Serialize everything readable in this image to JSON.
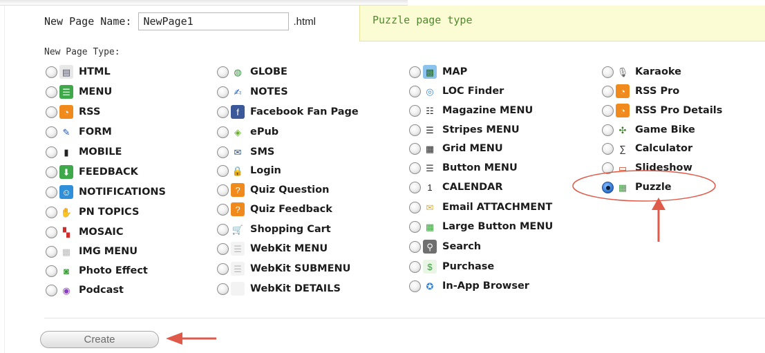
{
  "form": {
    "name_label": "New Page Name:",
    "name_value": "NewPage1",
    "extension": ".html",
    "hint": "Puzzle page type",
    "type_label": "New Page Type:",
    "create_label": "Create"
  },
  "selected": "Puzzle",
  "columns": [
    [
      {
        "label": "HTML",
        "icon": "document-icon",
        "glyph": "▤",
        "color": "#e8e8e8",
        "fg": "#556"
      },
      {
        "label": "MENU",
        "icon": "menu-list-icon",
        "glyph": "☰",
        "color": "#3fa84a",
        "fg": "#fff"
      },
      {
        "label": "RSS",
        "icon": "rss-icon",
        "glyph": "◔",
        "color": "#f08a1c",
        "fg": "#fff"
      },
      {
        "label": "FORM",
        "icon": "pencil-icon",
        "glyph": "✎",
        "color": "#ffffff",
        "fg": "#1b4fb0"
      },
      {
        "label": "MOBILE",
        "icon": "mobile-phone-icon",
        "glyph": "▮",
        "color": "#ffffff",
        "fg": "#222"
      },
      {
        "label": "FEEDBACK",
        "icon": "download-arrow-icon",
        "glyph": "⬇",
        "color": "#3fa84a",
        "fg": "#fff"
      },
      {
        "label": "NOTIFICATIONS",
        "icon": "smiley-notification-icon",
        "glyph": "☺",
        "color": "#2f8fd8",
        "fg": "#fff"
      },
      {
        "label": "PN TOPICS",
        "icon": "hand-topics-icon",
        "glyph": "✋",
        "color": "#ffffff",
        "fg": "#e0a020"
      },
      {
        "label": "MOSAIC",
        "icon": "mosaic-icon",
        "glyph": "▚",
        "color": "#ffffff",
        "fg": "#d42b2b"
      },
      {
        "label": "IMG MENU",
        "icon": "image-grid-icon",
        "glyph": "▦",
        "color": "#ffffff",
        "fg": "#bbb"
      },
      {
        "label": "Photo Effect",
        "icon": "camera-icon",
        "glyph": "◙",
        "color": "#ffffff",
        "fg": "#3b9a3b"
      },
      {
        "label": "Podcast",
        "icon": "podcast-icon",
        "glyph": "◉",
        "color": "#ffffff",
        "fg": "#8a3fc4"
      }
    ],
    [
      {
        "label": "GLOBE",
        "icon": "globe-icon",
        "glyph": "◍",
        "color": "#ffffff",
        "fg": "#2f8f3a"
      },
      {
        "label": "NOTES",
        "icon": "notes-icon",
        "glyph": "✍",
        "color": "#ffffff",
        "fg": "#2b5fb0"
      },
      {
        "label": "Facebook Fan Page",
        "icon": "facebook-icon",
        "glyph": "f",
        "color": "#3b5998",
        "fg": "#fff"
      },
      {
        "label": "ePub",
        "icon": "epub-icon",
        "glyph": "◈",
        "color": "#ffffff",
        "fg": "#6ab02f"
      },
      {
        "label": "SMS",
        "icon": "envelope-icon",
        "glyph": "✉",
        "color": "#ffffff",
        "fg": "#2a4f8a"
      },
      {
        "label": "Login",
        "icon": "lock-icon",
        "glyph": "🔒",
        "color": "#ffffff",
        "fg": "#c99a10"
      },
      {
        "label": "Quiz Question",
        "icon": "quiz-question-icon",
        "glyph": "?",
        "color": "#f08a1c",
        "fg": "#fff"
      },
      {
        "label": "Quiz Feedback",
        "icon": "quiz-feedback-icon",
        "glyph": "?",
        "color": "#f08a1c",
        "fg": "#fff"
      },
      {
        "label": "Shopping Cart",
        "icon": "shopping-cart-icon",
        "glyph": "🛒",
        "color": "#ffffff",
        "fg": "#222"
      },
      {
        "label": "WebKit MENU",
        "icon": "webkit-menu-icon",
        "glyph": "☰",
        "color": "#f3f3f3",
        "fg": "#bbb"
      },
      {
        "label": "WebKit SUBMENU",
        "icon": "webkit-submenu-icon",
        "glyph": "☰",
        "color": "#f3f3f3",
        "fg": "#bbb"
      },
      {
        "label": "WebKit DETAILS",
        "icon": "webkit-details-icon",
        "glyph": "",
        "color": "#f3f3f3",
        "fg": "#bbb"
      }
    ],
    [
      {
        "label": "MAP",
        "icon": "map-icon",
        "glyph": "▩",
        "color": "#8cc3ec",
        "fg": "#2a6e2a"
      },
      {
        "label": "LOC Finder",
        "icon": "location-finder-icon",
        "glyph": "◎",
        "color": "#ffffff",
        "fg": "#3b8fd8"
      },
      {
        "label": "Magazine MENU",
        "icon": "magazine-menu-icon",
        "glyph": "☷",
        "color": "#ffffff",
        "fg": "#222"
      },
      {
        "label": "Stripes MENU",
        "icon": "stripes-menu-icon",
        "glyph": "☰",
        "color": "#ffffff",
        "fg": "#222"
      },
      {
        "label": "Grid MENU",
        "icon": "grid-menu-icon",
        "glyph": "▦",
        "color": "#ffffff",
        "fg": "#222"
      },
      {
        "label": "Button MENU",
        "icon": "button-menu-icon",
        "glyph": "☰",
        "color": "#ffffff",
        "fg": "#333"
      },
      {
        "label": "CALENDAR",
        "icon": "calendar-icon",
        "glyph": "1",
        "color": "#ffffff",
        "fg": "#222"
      },
      {
        "label": "Email ATTACHMENT",
        "icon": "email-attachment-icon",
        "glyph": "✉",
        "color": "#ffffff",
        "fg": "#e0b020"
      },
      {
        "label": "Large Button MENU",
        "icon": "large-button-menu-icon",
        "glyph": "▦",
        "color": "#ffffff",
        "fg": "#3ba03b"
      },
      {
        "label": "Search",
        "icon": "search-icon",
        "glyph": "⚲",
        "color": "#6f6f6f",
        "fg": "#fff"
      },
      {
        "label": "Purchase",
        "icon": "purchase-icon",
        "glyph": "$",
        "color": "#e9f6e6",
        "fg": "#3b9a3b"
      },
      {
        "label": "In-App Browser",
        "icon": "browser-compass-icon",
        "glyph": "✪",
        "color": "#ffffff",
        "fg": "#2f7fd8"
      }
    ],
    [
      {
        "label": "Karaoke",
        "icon": "microphone-icon",
        "glyph": "🎙",
        "color": "#ffffff",
        "fg": "#666"
      },
      {
        "label": "RSS Pro",
        "icon": "rss-pro-icon",
        "glyph": "◔",
        "color": "#f08a1c",
        "fg": "#fff"
      },
      {
        "label": "RSS Pro Details",
        "icon": "rss-pro-details-icon",
        "glyph": "◔",
        "color": "#f08a1c",
        "fg": "#fff"
      },
      {
        "label": "Game Bike",
        "icon": "game-controller-icon",
        "glyph": "✣",
        "color": "#ffffff",
        "fg": "#3a7a2a"
      },
      {
        "label": "Calculator",
        "icon": "sigma-calculator-icon",
        "glyph": "∑",
        "color": "#ffffff",
        "fg": "#222"
      },
      {
        "label": "Slideshow",
        "icon": "slideshow-icon",
        "glyph": "▭",
        "color": "#ffffff",
        "fg": "#c04020"
      },
      {
        "label": "Puzzle",
        "icon": "puzzle-grid-icon",
        "glyph": "▦",
        "color": "#ffffff",
        "fg": "#3b9a3b"
      }
    ]
  ],
  "accent": {
    "annotation_red": "#e05a4a"
  }
}
